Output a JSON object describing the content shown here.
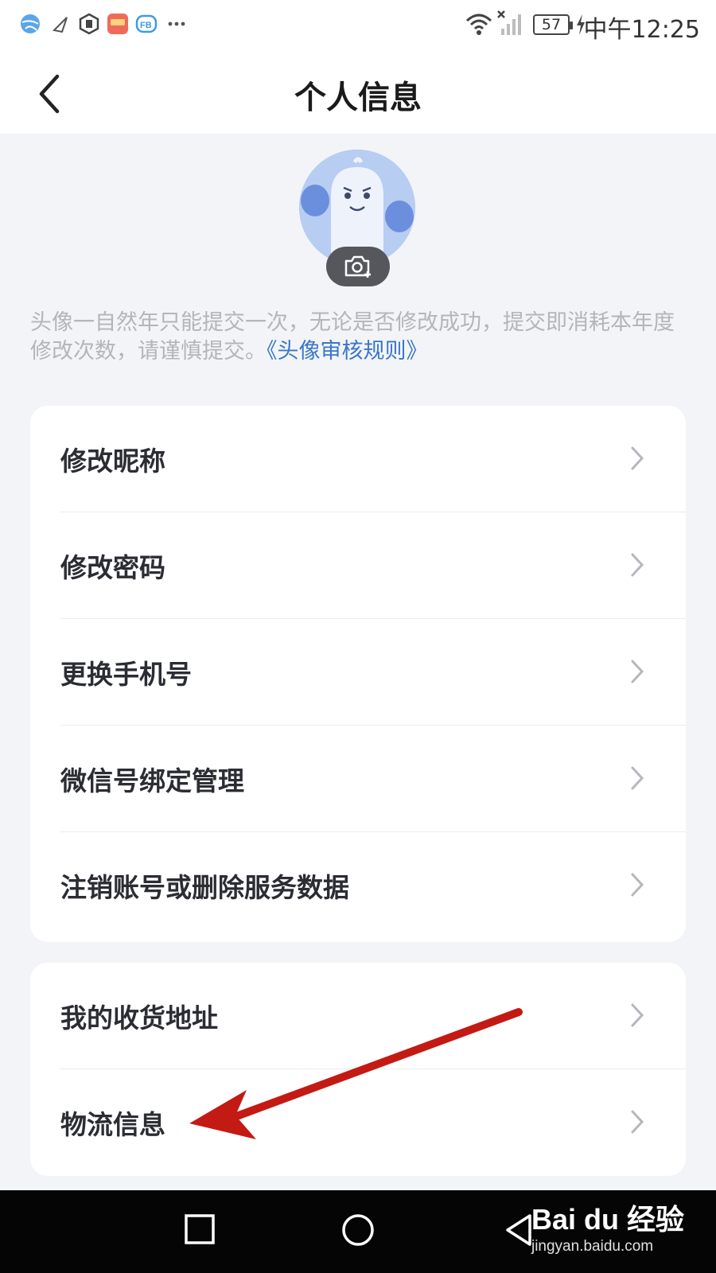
{
  "status_bar": {
    "time": "中午12:25",
    "battery": "57",
    "icons": [
      "app-globe-icon",
      "send-icon",
      "hexagon-app-icon",
      "gallery-app-icon",
      "fb-app-icon",
      "more-notifications-icon",
      "wifi-icon",
      "no-signal-icon",
      "battery-icon",
      "charging-icon"
    ]
  },
  "header": {
    "title": "个人信息",
    "back_icon": "chevron-left-icon"
  },
  "avatar": {
    "camera_icon": "camera-plus-icon",
    "notice_text": "头像一自然年只能提交一次，无论是否修改成功，提交即消耗本年度修改次数，请谨慎提交。",
    "notice_link": "《头像审核规则》"
  },
  "account_card": {
    "items": [
      {
        "label": "修改昵称"
      },
      {
        "label": "修改密码"
      },
      {
        "label": "更换手机号"
      },
      {
        "label": "微信号绑定管理"
      },
      {
        "label": "注销账号或删除服务数据"
      }
    ]
  },
  "address_card": {
    "items": [
      {
        "label": "我的收货地址"
      },
      {
        "label": "物流信息"
      }
    ]
  },
  "nav_bar": {
    "icons": [
      "recent-apps-icon",
      "home-icon",
      "back-triangle-icon"
    ]
  },
  "watermark": {
    "brand": "Bai du 经验",
    "url": "jingyan.baidu.com"
  },
  "annotation": {
    "color": "#c41a14"
  }
}
